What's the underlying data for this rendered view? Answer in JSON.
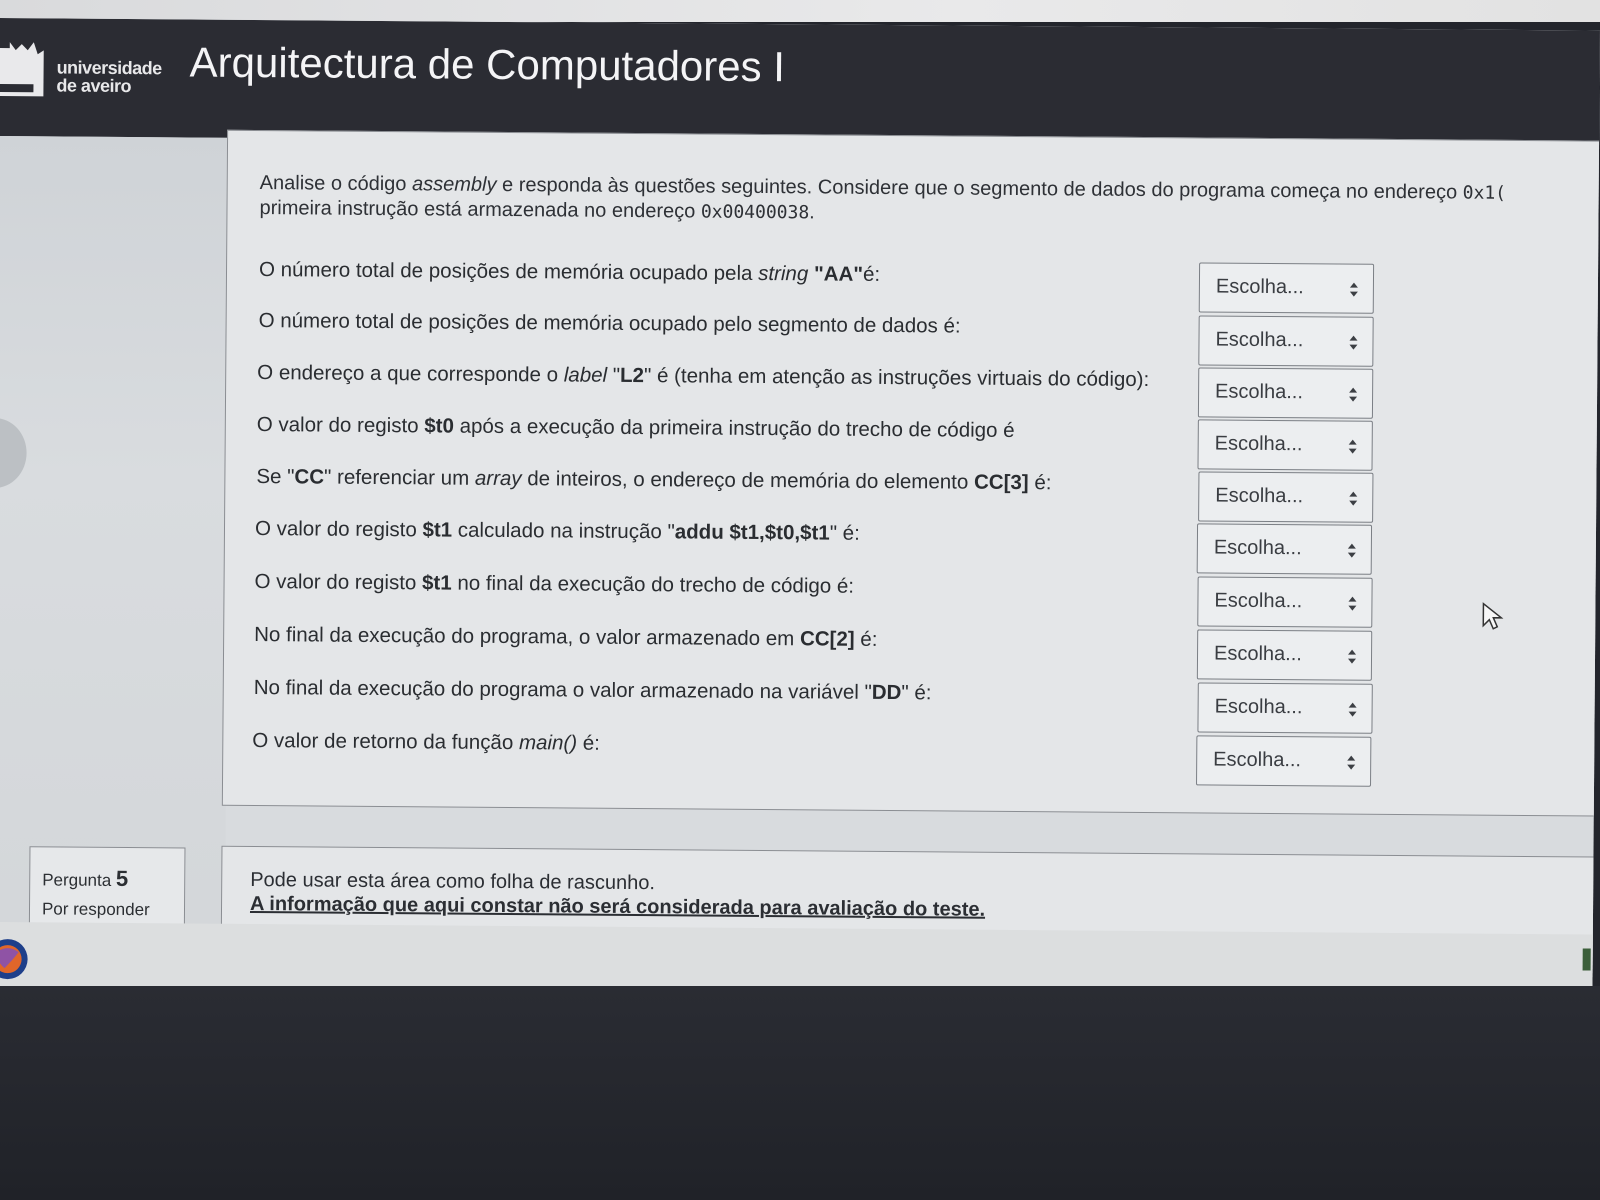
{
  "header": {
    "logo_icon": "universidade-de-aveiro-logo",
    "university_line1": "universidade",
    "university_line2": "de aveiro",
    "course_title": "Arquitectura de Computadores I"
  },
  "intro": {
    "part1": "Analise o código ",
    "part1_em": "assembly",
    "part2": " e responda às questões seguintes. Considere que o segmento de dados do programa começa no endereço ",
    "part2_code": "0x1(",
    "line2_text": "primeira instrução está armazenada no endereço ",
    "line2_code": "0x00400038",
    "line2_end": "."
  },
  "questions": [
    {
      "a": "O número total de posições de memória ocupado pela ",
      "em": "string",
      "b": " ",
      "strong": "\"AA\"",
      "c": "é:",
      "select": "Escolha..."
    },
    {
      "a": "O número total de posições de memória ocupado pelo segmento de dados é:",
      "em": "",
      "b": "",
      "strong": "",
      "c": "",
      "select": "Escolha..."
    },
    {
      "a": "O endereço a que corresponde o ",
      "em": "label",
      "b": " \"",
      "strong": "L2",
      "c": "\" é (tenha em atenção as instruções virtuais do código):",
      "select": "Escolha..."
    },
    {
      "a": "O valor do registo ",
      "em": "",
      "b": "",
      "strong": "$t0",
      "c": " após a execução da primeira instrução do trecho de código é",
      "select": "Escolha..."
    },
    {
      "a": "Se \"",
      "em": "",
      "b": "",
      "strong": "CC",
      "c": "\" referenciar um ",
      "em2": "array",
      "d": " de inteiros, o endereço de memória do elemento ",
      "strong2": "CC[3]",
      "e": " é:",
      "select": "Escolha..."
    },
    {
      "a": "O valor do registo ",
      "em": "",
      "b": "",
      "strong": "$t1",
      "c": " calculado na instrução \"",
      "strong2": "addu  $t1,$t0,$t1",
      "e": "\" é:",
      "select": "Escolha..."
    },
    {
      "a": "O valor do registo ",
      "em": "",
      "b": "",
      "strong": "$t1",
      "c": " no final da execução do trecho de código é:",
      "select": "Escolha..."
    },
    {
      "a": "No final da execução do programa, o valor armazenado em ",
      "em": "",
      "b": "",
      "strong": "CC[2]",
      "c": " é:",
      "select": "Escolha..."
    },
    {
      "a": "No final da execução do programa o valor armazenado na variável \"",
      "em": "",
      "b": "",
      "strong": "DD",
      "c": "\" é:",
      "select": "Escolha..."
    },
    {
      "a": "O valor de retorno da função ",
      "em": "main()",
      "b": "",
      "strong": "",
      "c": " é:",
      "select": "Escolha..."
    }
  ],
  "question_info": {
    "label": "Pergunta",
    "number": "5",
    "status": "Por responder"
  },
  "scratch": {
    "line1": "Pode usar esta área como folha de rascunho.",
    "line2": "A informação que aqui constar não será considerada para avaliação do teste."
  },
  "icons": {
    "select_arrow": "up-down-arrow-icon",
    "cursor": "mouse-pointer-icon",
    "taskbar_app": "firefox-icon"
  },
  "colors": {
    "header_bg": "#2b2c33",
    "panel_bg": "#e4e6e8",
    "border": "#8a8d92"
  }
}
